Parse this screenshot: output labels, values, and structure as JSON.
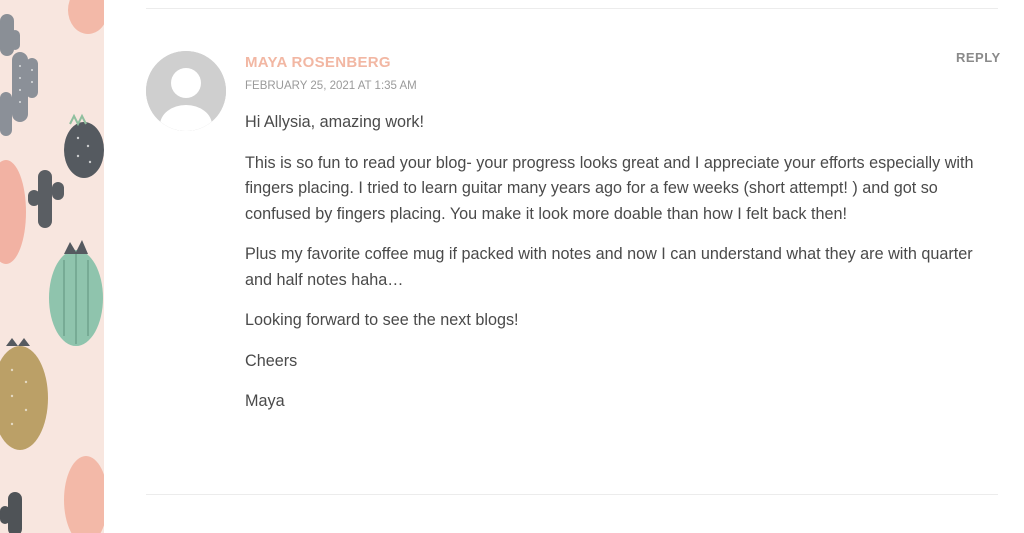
{
  "comment": {
    "author": "MAYA ROSENBERG",
    "date": "FEBRUARY 25, 2021 AT 1:35 AM",
    "reply_label": "REPLY",
    "paragraphs": [
      "Hi Allysia, amazing work!",
      "This is so fun to read your blog- your progress looks great and I appreciate your efforts especially with fingers placing. I tried to learn guitar many years ago for a few weeks (short attempt! ) and got so confused by fingers placing. You make it look more doable than how I felt back then!",
      "Plus my favorite coffee mug if packed with notes and now I can understand what they are with quarter and half notes haha…",
      "Looking forward to see the next blogs!",
      "Cheers",
      "Maya"
    ]
  },
  "colors": {
    "author": "#f2b7a3",
    "text": "#4a4a4a",
    "meta": "#9a9a9a",
    "sidebar_bg": "#f8e6df"
  },
  "icons": {
    "avatar": "default-user-avatar-icon",
    "pattern": "cactus-pattern"
  }
}
